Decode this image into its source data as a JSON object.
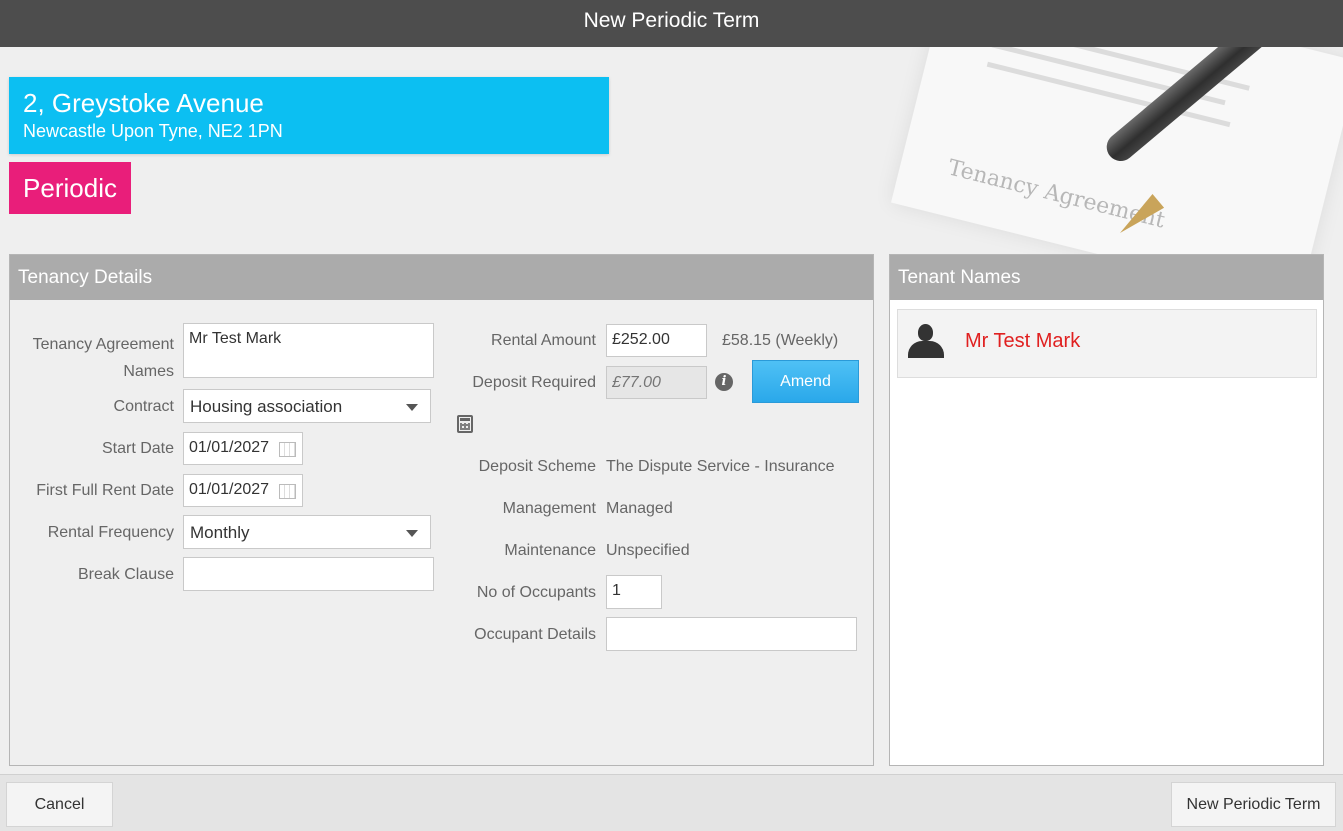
{
  "window": {
    "title": "New Periodic Term"
  },
  "decoration": {
    "document_text": "Tenancy Agreement"
  },
  "property": {
    "line1": "2, Greystoke Avenue",
    "line2": "Newcastle Upon Tyne, NE2 1PN"
  },
  "term_type": "Periodic",
  "details": {
    "title": "Tenancy Details",
    "agreement_names": {
      "label": "Tenancy Agreement Names",
      "value": "Mr Test Mark"
    },
    "contract": {
      "label": "Contract",
      "value": "Housing association"
    },
    "start_date": {
      "label": "Start Date",
      "value": "01/01/2027"
    },
    "first_full_rent_date": {
      "label": "First Full Rent Date",
      "value": "01/01/2027"
    },
    "rental_frequency": {
      "label": "Rental Frequency",
      "value": "Monthly"
    },
    "break_clause": {
      "label": "Break Clause",
      "value": ""
    },
    "rental_amount": {
      "label": "Rental Amount",
      "value": "£252.00",
      "weekly": "£58.15 (Weekly)"
    },
    "deposit_required": {
      "label": "Deposit Required",
      "placeholder": "£77.00"
    },
    "amend_label": "Amend",
    "deposit_scheme": {
      "label": "Deposit Scheme",
      "value": "The Dispute Service - Insurance"
    },
    "management": {
      "label": "Management",
      "value": "Managed"
    },
    "maintenance": {
      "label": "Maintenance",
      "value": "Unspecified"
    },
    "occupants": {
      "label": "No of Occupants",
      "value": "1"
    },
    "occupant_details": {
      "label": "Occupant Details",
      "value": ""
    }
  },
  "tenants": {
    "title": "Tenant Names",
    "items": [
      {
        "name": "Mr Test Mark"
      }
    ]
  },
  "footer": {
    "cancel_label": "Cancel",
    "submit_label": "New Periodic Term"
  },
  "colors": {
    "address_bg": "#0cbff2",
    "badge_bg": "#e91e7a",
    "tenant_name": "#e02020",
    "amend_bg": "#2aa8ea"
  },
  "icons": [
    "calendar-icon",
    "info-icon",
    "calculator-icon",
    "person-icon",
    "dropdown-caret-icon"
  ]
}
